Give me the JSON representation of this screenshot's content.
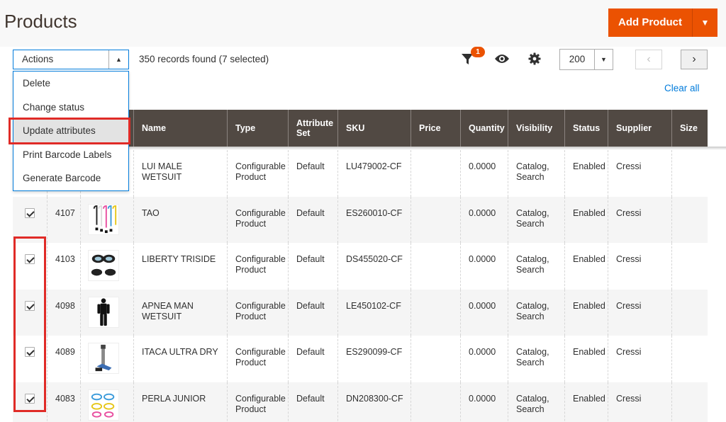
{
  "header": {
    "title": "Products",
    "add_label": "Add Product"
  },
  "toolbar": {
    "actions_label": "Actions",
    "records": "350 records found (7 selected)",
    "filter_badge": "1",
    "per_page": "200",
    "clear_all": "Clear all"
  },
  "actions_menu": [
    "Delete",
    "Change status",
    "Update attributes",
    "Print Barcode Labels",
    "Generate Barcode"
  ],
  "columns": [
    "Name",
    "Type",
    "Attribute Set",
    "SKU",
    "Price",
    "Quantity",
    "Visibility",
    "Status",
    "Supplier",
    "Size"
  ],
  "rows": [
    {
      "id": "",
      "checked": false,
      "name": "LUI MALE WETSUIT",
      "type": "Configurable Product",
      "set": "Default",
      "sku": "LU479002-CF",
      "price": "",
      "qty": "0.0000",
      "visibility": "Catalog, Search",
      "status": "Enabled",
      "supplier": "Cressi",
      "thumb": "none"
    },
    {
      "id": "4107",
      "checked": true,
      "name": "TAO",
      "type": "Configurable Product",
      "set": "Default",
      "sku": "ES260010-CF",
      "price": "",
      "qty": "0.0000",
      "visibility": "Catalog, Search",
      "status": "Enabled",
      "supplier": "Cressi",
      "thumb": "snorkels"
    },
    {
      "id": "4103",
      "checked": true,
      "name": "LIBERTY TRISIDE",
      "type": "Configurable Product",
      "set": "Default",
      "sku": "DS455020-CF",
      "price": "",
      "qty": "0.0000",
      "visibility": "Catalog, Search",
      "status": "Enabled",
      "supplier": "Cressi",
      "thumb": "masks"
    },
    {
      "id": "4098",
      "checked": true,
      "name": "APNEA MAN WETSUIT",
      "type": "Configurable Product",
      "set": "Default",
      "sku": "LE450102-CF",
      "price": "",
      "qty": "0.0000",
      "visibility": "Catalog, Search",
      "status": "Enabled",
      "supplier": "Cressi",
      "thumb": "wetsuit"
    },
    {
      "id": "4089",
      "checked": true,
      "name": "ITACA ULTRA DRY",
      "type": "Configurable Product",
      "set": "Default",
      "sku": "ES290099-CF",
      "price": "",
      "qty": "0.0000",
      "visibility": "Catalog, Search",
      "status": "Enabled",
      "supplier": "Cressi",
      "thumb": "snorkel"
    },
    {
      "id": "4083",
      "checked": true,
      "name": "PERLA JUNIOR",
      "type": "Configurable Product",
      "set": "Default",
      "sku": "DN208300-CF",
      "price": "",
      "qty": "0.0000",
      "visibility": "Catalog, Search",
      "status": "Enabled",
      "supplier": "Cressi",
      "thumb": "goggles"
    }
  ],
  "colors": {
    "accent": "#eb5202",
    "header_bg": "#514943",
    "link": "#007bdb",
    "highlight": "#e02b27"
  }
}
